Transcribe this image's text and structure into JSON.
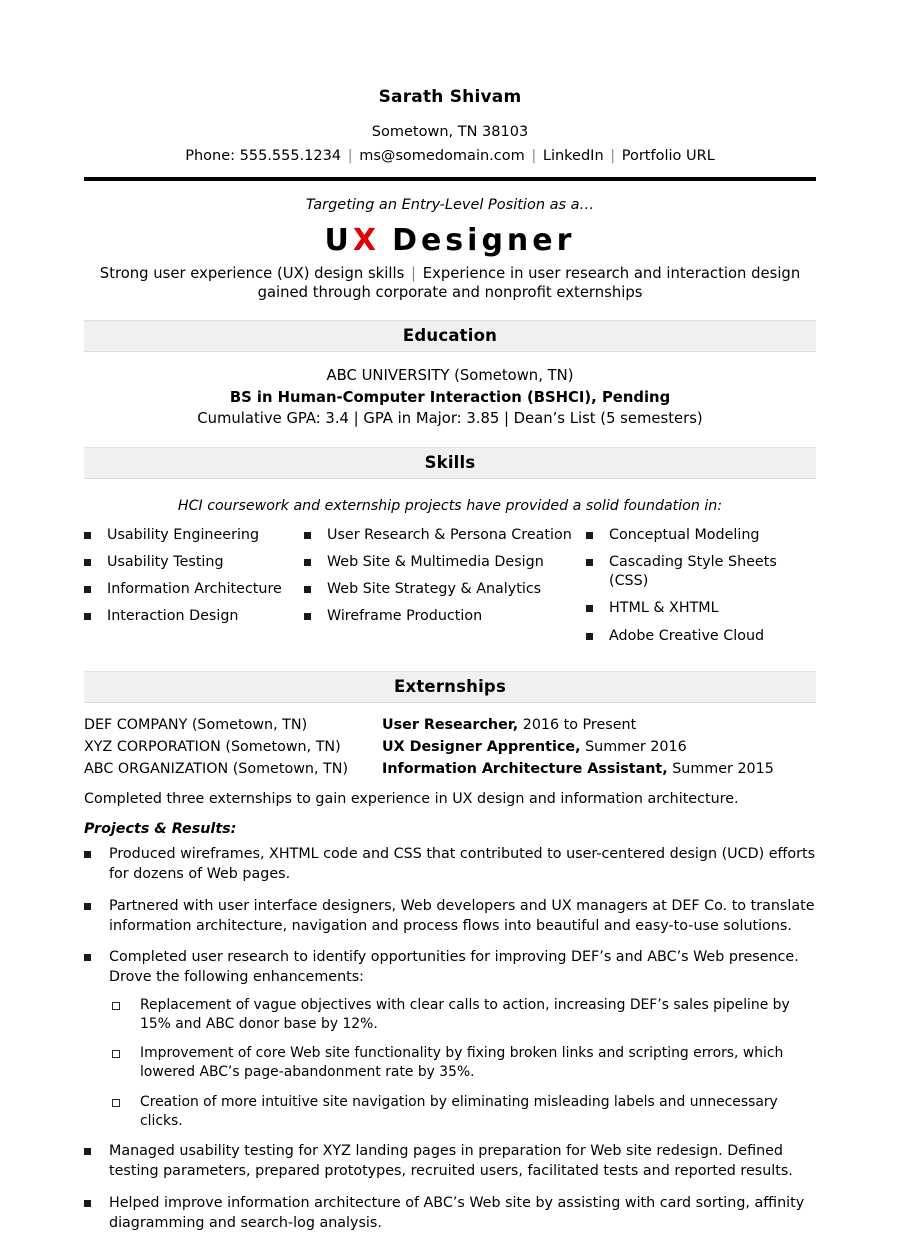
{
  "header": {
    "name": "Sarath Shivam",
    "location": "Sometown, TN 38103",
    "phone": "Phone: 555.555.1234",
    "email": "ms@somedomain.com",
    "linkedin": "LinkedIn",
    "portfolio": "Portfolio URL",
    "separator": "|"
  },
  "title": {
    "targeting": "Targeting an Entry-Level Position as a…",
    "job_u": "U",
    "job_x": "X",
    "job_rest": "Designer",
    "tagline_left": "Strong user experience (UX) design skills",
    "tagline_sep": "|",
    "tagline_right": "Experience in user research and interaction design",
    "tagline_line2": "gained through corporate and nonprofit externships",
    "accent_color": "#e10000"
  },
  "education": {
    "section_label": "Education",
    "school": "ABC UNIVERSITY (Sometown, TN)",
    "degree": "BS in Human-Computer Interaction (BSHCI), Pending",
    "honors": "Cumulative GPA: 3.4 | GPA in Major: 3.85 | Dean’s List (5 semesters)"
  },
  "skills": {
    "section_label": "Skills",
    "intro": "HCI coursework and externship projects have provided a solid foundation in:",
    "column1": [
      "Usability Engineering",
      "Usability Testing",
      "Information Architecture",
      "Interaction Design"
    ],
    "column2": [
      "User Research & Persona Creation",
      "Web Site & Multimedia Design",
      "Web Site Strategy & Analytics",
      "Wireframe Production"
    ],
    "column3": [
      "Conceptual Modeling",
      "Cascading Style Sheets (CSS)",
      "HTML & XHTML",
      "Adobe Creative Cloud"
    ]
  },
  "externships": {
    "section_label": "Externships",
    "rows": [
      {
        "company": "DEF COMPANY (Sometown, TN)",
        "role": "User Researcher,",
        "dates": "2016 to Present"
      },
      {
        "company": "XYZ CORPORATION (Sometown, TN)",
        "role": "UX Designer Apprentice,",
        "dates": "Summer 2016"
      },
      {
        "company": "ABC ORGANIZATION (Sometown, TN)",
        "role": "Information Architecture Assistant,",
        "dates": "Summer 2015"
      }
    ],
    "summary": "Completed three externships to gain experience in UX design and information architecture.",
    "projects_heading": "Projects & Results:",
    "bullets": [
      "Produced wireframes, XHTML code and CSS that contributed to user-centered design (UCD) efforts for dozens of Web pages.",
      "Partnered with user interface designers, Web developers and UX managers at DEF Co. to translate information architecture, navigation and process flows into beautiful and easy-to-use solutions.",
      "Completed user research to identify opportunities for improving DEF’s and ABC’s Web presence. Drove the following enhancements:"
    ],
    "sub_bullets": [
      "Replacement of vague objectives with clear calls to action, increasing DEF’s sales pipeline by 15% and ABC donor base by 12%.",
      "Improvement of core Web site functionality by fixing broken links and scripting errors, which lowered ABC’s page-abandonment rate by 35%.",
      "Creation of more intuitive site navigation by eliminating misleading labels and unnecessary clicks."
    ],
    "bullets_tail": [
      "Managed usability testing for XYZ landing pages in preparation for Web site redesign. Defined testing parameters, prepared prototypes, recruited users, facilitated tests and reported results.",
      "Helped improve information architecture of ABC’s Web site by assisting with card sorting, affinity diagramming and search-log analysis."
    ]
  }
}
